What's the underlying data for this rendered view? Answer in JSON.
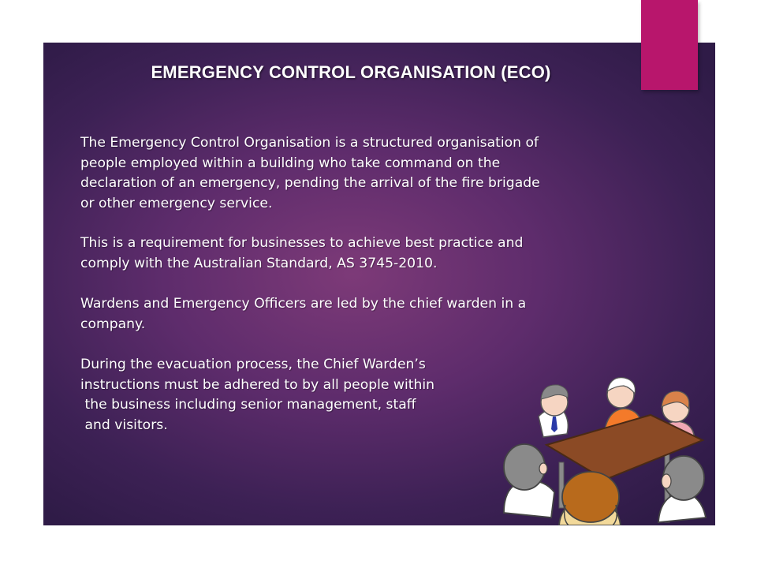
{
  "slide": {
    "title": "EMERGENCY CONTROL ORGANISATION (ECO)",
    "paragraphs": [
      {
        "lines": [
          "The Emergency Control Organisation is a structured organisation of",
          "people employed within a building who take command on the",
          "declaration of an emergency, pending the arrival of the fire brigade",
          "or other emergency service."
        ]
      },
      {
        "lines": [
          "This is a requirement for businesses to achieve best practice and",
          "comply with the Australian Standard, AS 3745-2010."
        ]
      },
      {
        "lines": [
          "Wardens and Emergency Officers are led by the chief warden in a",
          "company."
        ]
      },
      {
        "lines": [
          "During the evacuation process, the Chief Warden’s",
          "instructions must be adhered to by all people within",
          " the business including senior management, staff",
          " and visitors."
        ]
      }
    ]
  },
  "colors": {
    "accent": "#b8166c",
    "background_dark": "#2f1b47",
    "background_light": "#7d3a78",
    "text": "#ffffff"
  },
  "illustration": {
    "icon": "meeting-table-people-icon"
  }
}
